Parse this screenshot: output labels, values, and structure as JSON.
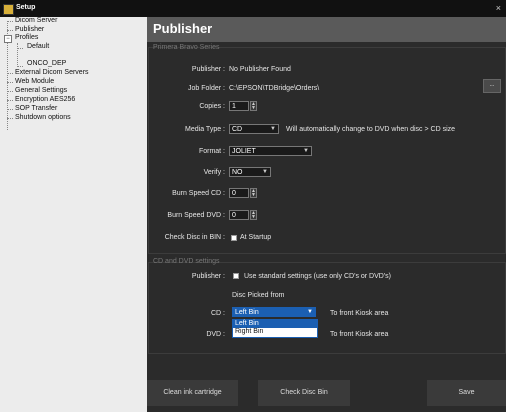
{
  "window": {
    "title": "Setup",
    "close_glyph": "×"
  },
  "tree": {
    "items": [
      {
        "label": "Dicom Server"
      },
      {
        "label": "Publisher"
      },
      {
        "label": "Profiles",
        "expander": "−"
      },
      {
        "label": "Default"
      },
      {
        "label": "ONCO_DEP"
      },
      {
        "label": "External Dicom Servers"
      },
      {
        "label": "Web Module"
      },
      {
        "label": "General Settings"
      },
      {
        "label": "Encryption AES256"
      },
      {
        "label": "SOP Transfer"
      },
      {
        "label": "Shutdown options"
      }
    ]
  },
  "header": {
    "title": "Publisher"
  },
  "bravo": {
    "section_title": "Primera Bravo Series",
    "publisher_label": "Publisher :",
    "publisher_value": "No Publisher Found",
    "job_folder_label": "Job Folder :",
    "job_folder_value": "C:\\EPSON\\TDBridge\\Orders\\",
    "browse_label": "...",
    "copies_label": "Copies :",
    "copies_value": "1",
    "media_type_label": "Media Type :",
    "media_type_value": "CD",
    "media_type_note": "Will automatically change to DVD when disc > CD size",
    "format_label": "Format :",
    "format_value": "JOLIET",
    "verify_label": "Verify :",
    "verify_value": "NO",
    "burn_cd_label": "Burn Speed CD :",
    "burn_cd_value": "0",
    "burn_dvd_label": "Burn Speed DVD :",
    "burn_dvd_value": "0",
    "check_bin_label": "Check Disc in BIN :",
    "check_bin_option": "At Startup"
  },
  "cddvd": {
    "section_title": "CD and DVD settings",
    "publisher_label": "Publisher :",
    "use_standard_label": "Use standard settings (use only CD's or DVD's)",
    "disc_picked_label": "Disc Picked from",
    "cd_label": "CD :",
    "cd_value": "Left Bin",
    "cd_options": [
      "Left Bin",
      "Right Bin"
    ],
    "cd_dest": "To front Kiosk area",
    "dvd_label": "DVD :",
    "dvd_dest": "To front Kiosk area"
  },
  "footer": {
    "clean_label": "Clean ink cartridge",
    "check_bin_label": "Check Disc Bin",
    "save_label": "Save"
  }
}
